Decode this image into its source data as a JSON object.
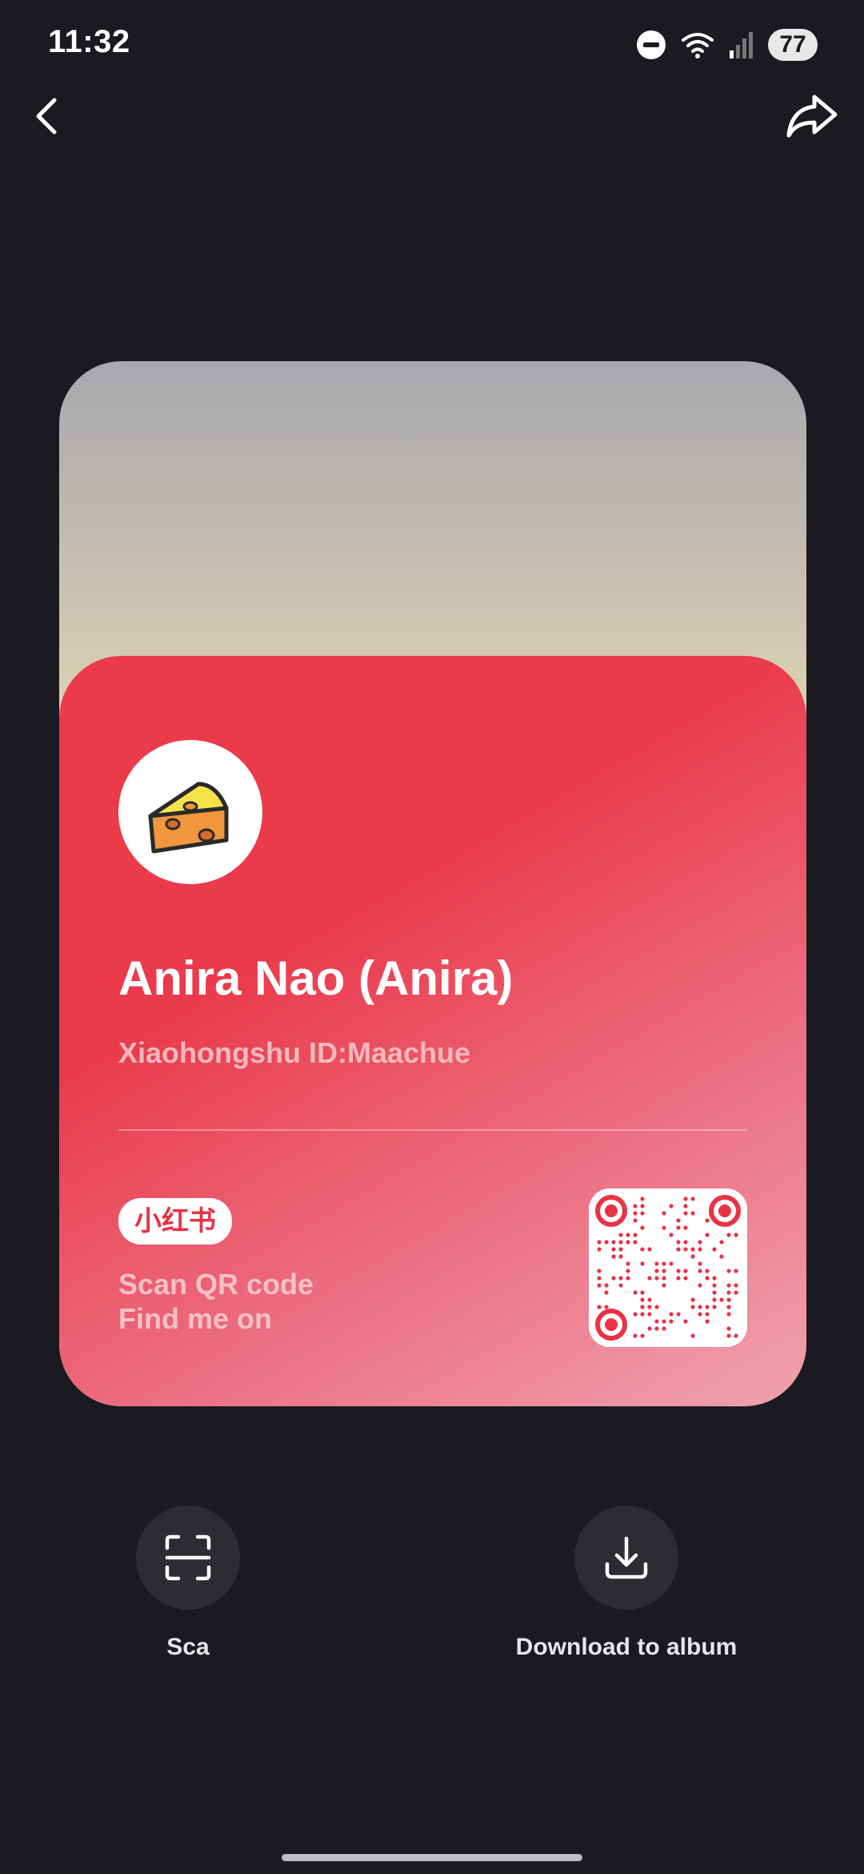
{
  "status_bar": {
    "time": "11:32",
    "battery": "77",
    "icons": [
      "do-not-disturb-icon",
      "wifi-icon",
      "cellular-signal-icon",
      "battery-icon"
    ]
  },
  "nav": {
    "back_icon": "chevron-left-icon",
    "share_icon": "share-arrow-icon"
  },
  "card": {
    "avatar_icon": "cheese-icon",
    "name": "Anira Nao (Anira)",
    "id_text": "Xiaohongshu ID:Maachue",
    "brand": "小红书",
    "scan_line1": "Scan QR code",
    "scan_line2": "Find me on",
    "qr_icon": "qr-code",
    "colors": {
      "red": "#ea3a4b",
      "accent": "#e83347"
    }
  },
  "actions": [
    {
      "label": "Sca",
      "icon": "scan-icon"
    },
    {
      "label": "Download to album",
      "icon": "download-icon"
    }
  ]
}
